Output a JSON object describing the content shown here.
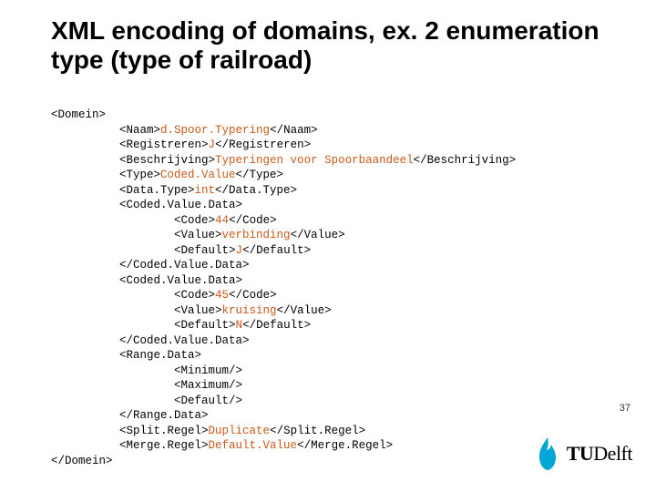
{
  "title": "XML encoding of domains, ex. 2 enumeration type (type of railroad)",
  "page_number": "37",
  "logo": {
    "tu": "TU",
    "delft": "Delft",
    "icon_name": "flame-icon"
  },
  "xml": {
    "root_open": "<Domein>",
    "naam": {
      "open": "<Naam>",
      "val": "d.Spoor.Typering",
      "close": "</Naam>"
    },
    "registreren": {
      "open": "<Registreren>",
      "val": "J",
      "close": "</Registreren>"
    },
    "beschrijving": {
      "open": "<Beschrijving>",
      "val": "Typeringen voor Spoorbaandeel",
      "close": "</Beschrijving>"
    },
    "type": {
      "open": "<Type>",
      "val": "Coded.Value",
      "close": "</Type>"
    },
    "datatype": {
      "open": "<Data.Type>",
      "val": "int",
      "close": "</Data.Type>"
    },
    "cvd1": {
      "open": "<Coded.Value.Data>",
      "code": {
        "open": "<Code>",
        "val": "44",
        "close": "</Code>"
      },
      "value": {
        "open": "<Value>",
        "val": "verbinding",
        "close": "</Value>"
      },
      "default": {
        "open": "<Default>",
        "val": "J",
        "close": "</Default>"
      },
      "close": "</Coded.Value.Data>"
    },
    "cvd2": {
      "open": "<Coded.Value.Data>",
      "code": {
        "open": "<Code>",
        "val": "45",
        "close": "</Code>"
      },
      "value": {
        "open": "<Value>",
        "val": "kruising",
        "close": "</Value>"
      },
      "default": {
        "open": "<Default>",
        "val": "N",
        "close": "</Default>"
      },
      "close": "</Coded.Value.Data>"
    },
    "range": {
      "open": "<Range.Data>",
      "minimum": "<Minimum/>",
      "maximum": "<Maximum/>",
      "default": "<Default/>",
      "close": "</Range.Data>"
    },
    "split": {
      "open": "<Split.Regel>",
      "val": "Duplicate",
      "close": "</Split.Regel>"
    },
    "merge": {
      "open": "<Merge.Regel>",
      "val": "Default.Value",
      "close": "</Merge.Regel>"
    },
    "root_close": "</Domein>"
  }
}
